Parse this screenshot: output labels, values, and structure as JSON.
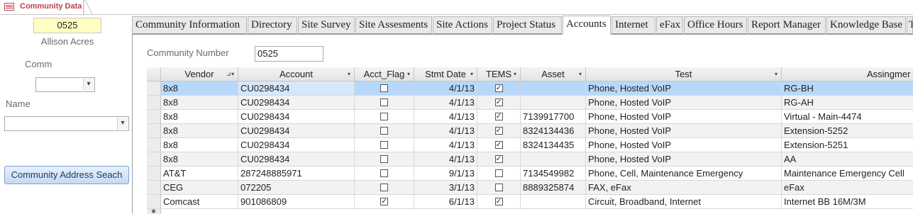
{
  "document_tab": {
    "title": "Community Data"
  },
  "left": {
    "community_number": "0525",
    "community_name": "Allison Acres",
    "comm_label": "Comm",
    "comm_value": "",
    "name_label": "Name",
    "name_value": "",
    "address_button": "Community Address Seach"
  },
  "tabs": [
    {
      "label": "Community Information",
      "active": false
    },
    {
      "label": "Directory",
      "active": false
    },
    {
      "label": "Site Survey",
      "active": false
    },
    {
      "label": "Site Assesments",
      "active": false
    },
    {
      "label": "Site Actions",
      "active": false
    },
    {
      "label": "Project Status",
      "active": false
    },
    {
      "label": "Accounts",
      "active": true
    },
    {
      "label": "Internet",
      "active": false
    },
    {
      "label": "eFax",
      "active": false
    },
    {
      "label": "Office Hours",
      "active": false
    },
    {
      "label": "Report Manager",
      "active": false
    },
    {
      "label": "Knowledge Base",
      "active": false
    },
    {
      "label": "T",
      "active": false
    }
  ],
  "accounts": {
    "community_number_label": "Community Number",
    "community_number_value": "0525",
    "columns": [
      "Vendor",
      "Account",
      "Acct_Flag",
      "Stmt Date",
      "TEMS",
      "Asset",
      "Test",
      "Assingmer"
    ],
    "rows": [
      {
        "vendor": "8x8",
        "account": "CU0298434",
        "acct_flag": false,
        "stmt_date": "4/1/13",
        "tems": true,
        "asset": "",
        "test": "Phone, Hosted VoIP",
        "assignment": "RG-BH",
        "selected": true
      },
      {
        "vendor": "8x8",
        "account": "CU0298434",
        "acct_flag": false,
        "stmt_date": "4/1/13",
        "tems": true,
        "asset": "",
        "test": "Phone, Hosted VoIP",
        "assignment": "RG-AH",
        "selected": false
      },
      {
        "vendor": "8x8",
        "account": "CU0298434",
        "acct_flag": false,
        "stmt_date": "4/1/13",
        "tems": true,
        "asset": "7139917700",
        "test": "Phone, Hosted VoIP",
        "assignment": "Virtual - Main-4474",
        "selected": false
      },
      {
        "vendor": "8x8",
        "account": "CU0298434",
        "acct_flag": false,
        "stmt_date": "4/1/13",
        "tems": true,
        "asset": "8324134436",
        "test": "Phone, Hosted VoIP",
        "assignment": "Extension-5252",
        "selected": false
      },
      {
        "vendor": "8x8",
        "account": "CU0298434",
        "acct_flag": false,
        "stmt_date": "4/1/13",
        "tems": true,
        "asset": "8324134435",
        "test": "Phone, Hosted VoIP",
        "assignment": "Extension-5251",
        "selected": false
      },
      {
        "vendor": "8x8",
        "account": "CU0298434",
        "acct_flag": false,
        "stmt_date": "4/1/13",
        "tems": true,
        "asset": "",
        "test": "Phone, Hosted VoIP",
        "assignment": "AA",
        "selected": false
      },
      {
        "vendor": "AT&T",
        "account": "287248885971",
        "acct_flag": false,
        "stmt_date": "9/1/13",
        "tems": false,
        "asset": "7134549982",
        "test": "Phone, Cell, Maintenance Emergency",
        "assignment": "Maintenance Emergency Cell",
        "selected": false
      },
      {
        "vendor": "CEG",
        "account": "072205",
        "acct_flag": false,
        "stmt_date": "3/1/13",
        "tems": false,
        "asset": "8889325874",
        "test": "FAX, eFax",
        "assignment": "eFax",
        "selected": false
      },
      {
        "vendor": "Comcast",
        "account": "901086809",
        "acct_flag": true,
        "stmt_date": "6/1/13",
        "tems": true,
        "asset": "",
        "test": "Circuit, Broadband, Internet",
        "assignment": "Internet BB 16M/3M",
        "selected": false
      }
    ]
  },
  "icons": {
    "form": "form-icon",
    "dropdown": "chevron-down-icon",
    "sort": "sort-arrow-icon",
    "checkbox_checked": "✓"
  },
  "colors": {
    "accent_title": "#b8434d",
    "selected_row": "#b8d8fb",
    "number_field": "#ffffc2"
  }
}
